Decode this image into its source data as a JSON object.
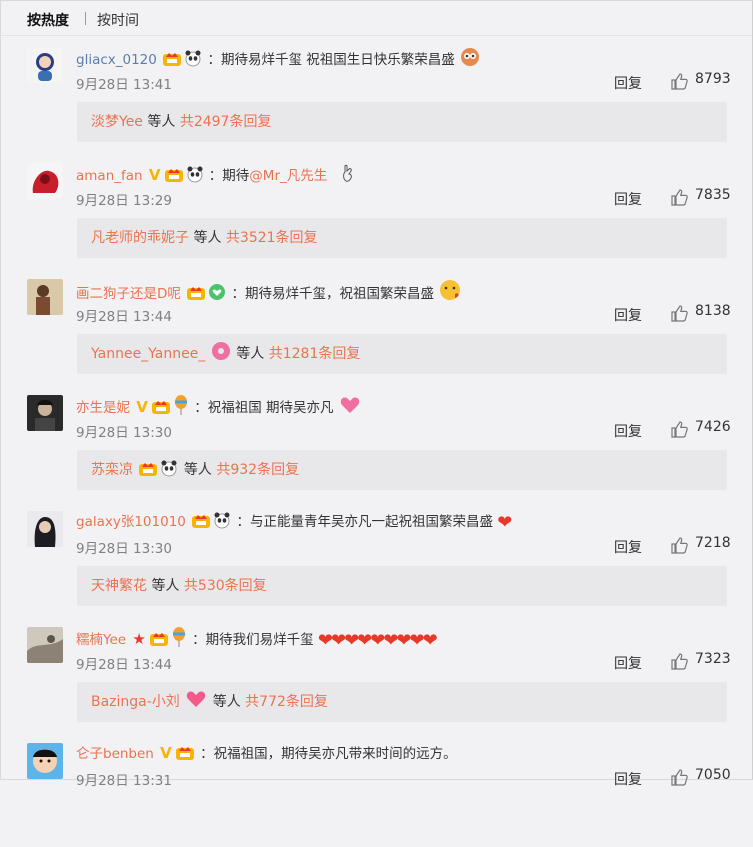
{
  "tabs": {
    "hot": "按热度",
    "time": "按时间"
  },
  "reply_label": "回复",
  "etc_label": "等人",
  "comments": [
    {
      "user": "gliacx_0120",
      "text": "：期待易烊千玺 祝祖国生日快乐繁荣昌盛",
      "time": "9月28日 13:41",
      "likes": "8793",
      "sub_user": "淡梦Yee",
      "sub_total": "共2497条回复"
    },
    {
      "user": "aman_fan",
      "text": "：期待",
      "mention": "@Mr_凡先生",
      "time": "9月28日 13:29",
      "likes": "7835",
      "sub_user": "凡老师的乖妮子",
      "sub_total": "共3521条回复"
    },
    {
      "user": "画二狗子还是D呢",
      "text": "：期待易烊千玺，祝祖国繁荣昌盛",
      "time": "9月28日 13:44",
      "likes": "8138",
      "sub_user": "Yannee_Yannee_",
      "sub_total": "共1281条回复"
    },
    {
      "user": "亦生是妮",
      "text": "：祝福祖国 期待吴亦凡",
      "time": "9月28日 13:30",
      "likes": "7426",
      "sub_user": "苏栾凉",
      "sub_total": "共932条回复"
    },
    {
      "user": "galaxy张101010",
      "text": "：与正能量青年吴亦凡一起祝祖国繁荣昌盛",
      "time": "9月28日 13:30",
      "likes": "7218",
      "sub_user": "天神繁花",
      "sub_total": "共530条回复"
    },
    {
      "user": "糯楠Yee",
      "text": "：期待我们易烊千玺",
      "time": "9月28日 13:44",
      "likes": "7323",
      "sub_user": "Bazinga-小刘",
      "sub_total": "共772条回复"
    },
    {
      "user": "仑子benben",
      "text": "：祝福祖国，期待吴亦凡带来时间的远方。",
      "time": "9月28日 13:31",
      "likes": "7050"
    }
  ],
  "colors": {
    "username": "#eb7350",
    "link_blue": "#5b7ea8",
    "time": "#808080",
    "sub_bg": "#e8e8ea",
    "page_bg": "#f2f2f5"
  },
  "icons": [
    "crown-member-icon",
    "panda-icon",
    "verified-v-icon",
    "thumb-up-icon",
    "heart-emoji-icon",
    "balloon-emoji-icon",
    "donut-emoji-icon",
    "star-badge-icon"
  ]
}
